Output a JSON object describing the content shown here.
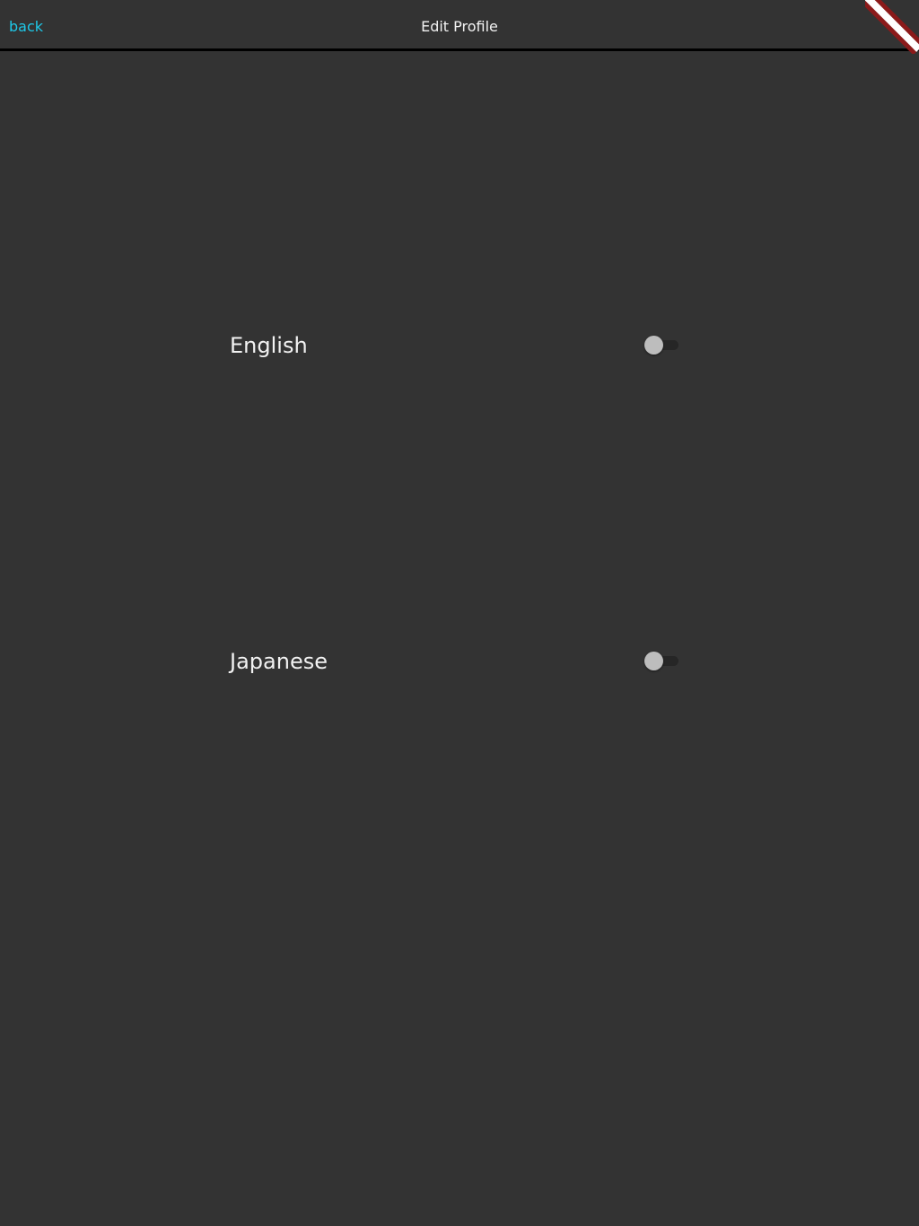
{
  "header": {
    "back_label": "back",
    "title": "Edit Profile"
  },
  "languages": [
    {
      "label": "English",
      "enabled": false
    },
    {
      "label": "Japanese",
      "enabled": false
    }
  ],
  "colors": {
    "background": "#333333",
    "accent": "#1ec8e8",
    "text": "#f2f2f2",
    "divider": "#000000",
    "debug_banner": "#8b1a1a"
  }
}
